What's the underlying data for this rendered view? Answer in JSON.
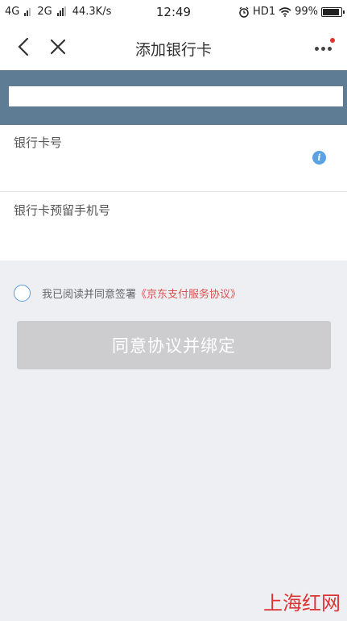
{
  "status_bar": {
    "network1": "4G",
    "network2": "2G",
    "speed": "44.3K/s",
    "time": "12:49",
    "hd_label": "HD1",
    "battery": "99%"
  },
  "nav": {
    "title": "添加银行卡"
  },
  "form": {
    "card_number_label": "银行卡号",
    "card_number_value": "",
    "phone_label": "银行卡预留手机号",
    "phone_value": ""
  },
  "agreement": {
    "text": "我已阅读并同意签署",
    "link": "《京东支付服务协议》",
    "checked": false
  },
  "bind_button": {
    "label": "同意协议并绑定",
    "enabled": false
  },
  "watermark": "上海红网",
  "colors": {
    "banner": "#5e7d95",
    "accent": "#5b9bd8",
    "link": "#d9534f",
    "disabled_button": "#cdcdcf"
  },
  "icons": [
    "back-icon",
    "close-icon",
    "more-icon",
    "info-icon",
    "alarm-icon",
    "wifi-icon",
    "battery-icon"
  ]
}
